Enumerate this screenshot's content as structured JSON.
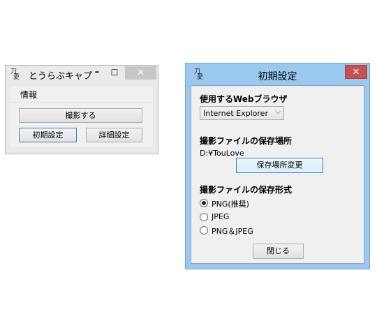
{
  "main_window": {
    "icon_text": [
      "刀",
      "愛"
    ],
    "title": "とうらぶキャプ",
    "minimize_glyph": "–",
    "maximize_glyph": "☐",
    "close_glyph": "✕",
    "menu_info": "情報",
    "shoot_button": "撮影する",
    "initial_settings_button": "初期設定",
    "detail_settings_button": "詳細設定"
  },
  "settings_dialog": {
    "icon_text": [
      "刀",
      "愛"
    ],
    "title": "初期設定",
    "close_glyph": "✕",
    "browser_heading": "使用するWebブラウザ",
    "browser_selected": "Internet Explorer",
    "dropdown_glyph": "⌵",
    "save_location_heading": "撮影ファイルの保存場所",
    "save_location_value": "D:¥TouLove",
    "change_location_button": "保存場所変更",
    "save_format_heading": "撮影ファイルの保存形式",
    "format_options": [
      {
        "label": "PNG(推奨)",
        "checked": true
      },
      {
        "label": "JPEG",
        "checked": false
      },
      {
        "label": "PNG＆JPEG",
        "checked": false
      }
    ],
    "close_button": "閉じる"
  },
  "colors": {
    "dialog_frame": "#99c9ef",
    "close_red": "#c75050",
    "focus_border": "#3c7fb1"
  }
}
